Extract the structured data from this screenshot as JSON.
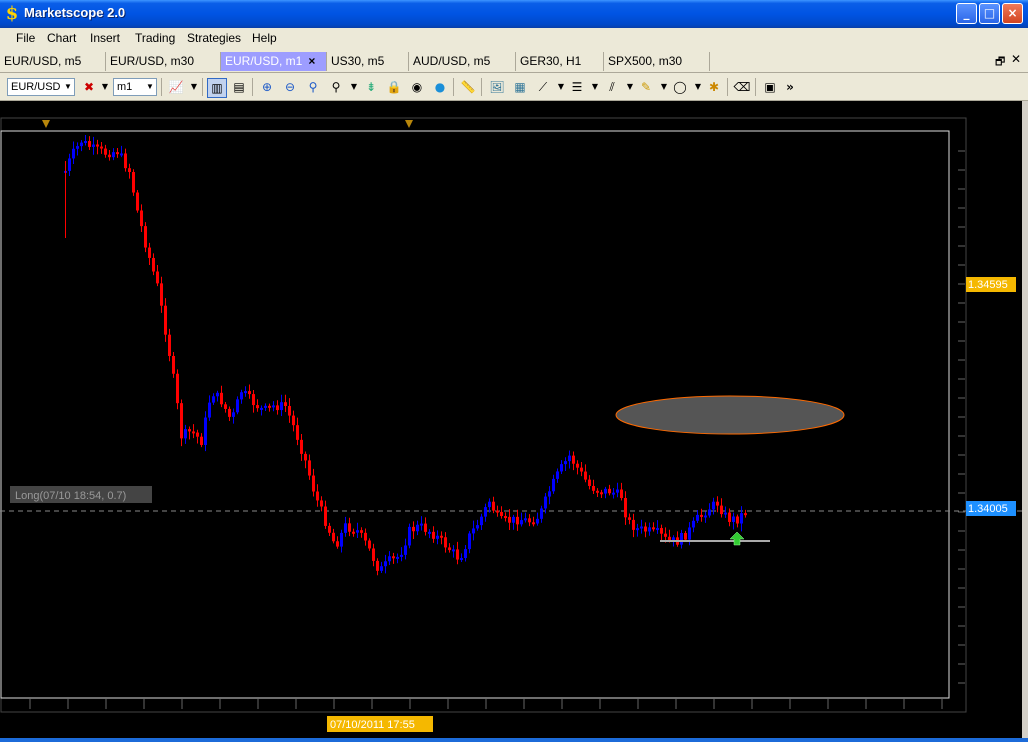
{
  "window": {
    "title": "Marketscope 2.0",
    "min": "_",
    "max": "□",
    "close": "×"
  },
  "menu": [
    "File",
    "Chart",
    "Insert",
    "Trading",
    "Strategies",
    "Help"
  ],
  "tabs": [
    {
      "label": "EUR/USD, m5"
    },
    {
      "label": "EUR/USD, m30"
    },
    {
      "label": "EUR/USD, m1",
      "active": true
    },
    {
      "label": "US30, m5"
    },
    {
      "label": "AUD/USD, m5"
    },
    {
      "label": "GER30, H1"
    },
    {
      "label": "SPX500, m30"
    }
  ],
  "tab_close": "×",
  "toolbar": {
    "symbol": "EUR/USD",
    "timeframe": "m1",
    "more": "»"
  },
  "chart": {
    "price_label_top": "1.34595",
    "price_label_current": "1.34005",
    "position_label": "Long(07/10 18:54, 0.7)",
    "time_label": "07/10/2011 17:55",
    "colors": {
      "bull": "#0000ff",
      "bear": "#ff0000",
      "background": "#000000",
      "ellipse": "#555555",
      "ellipse_border": "#ff6a00"
    }
  }
}
